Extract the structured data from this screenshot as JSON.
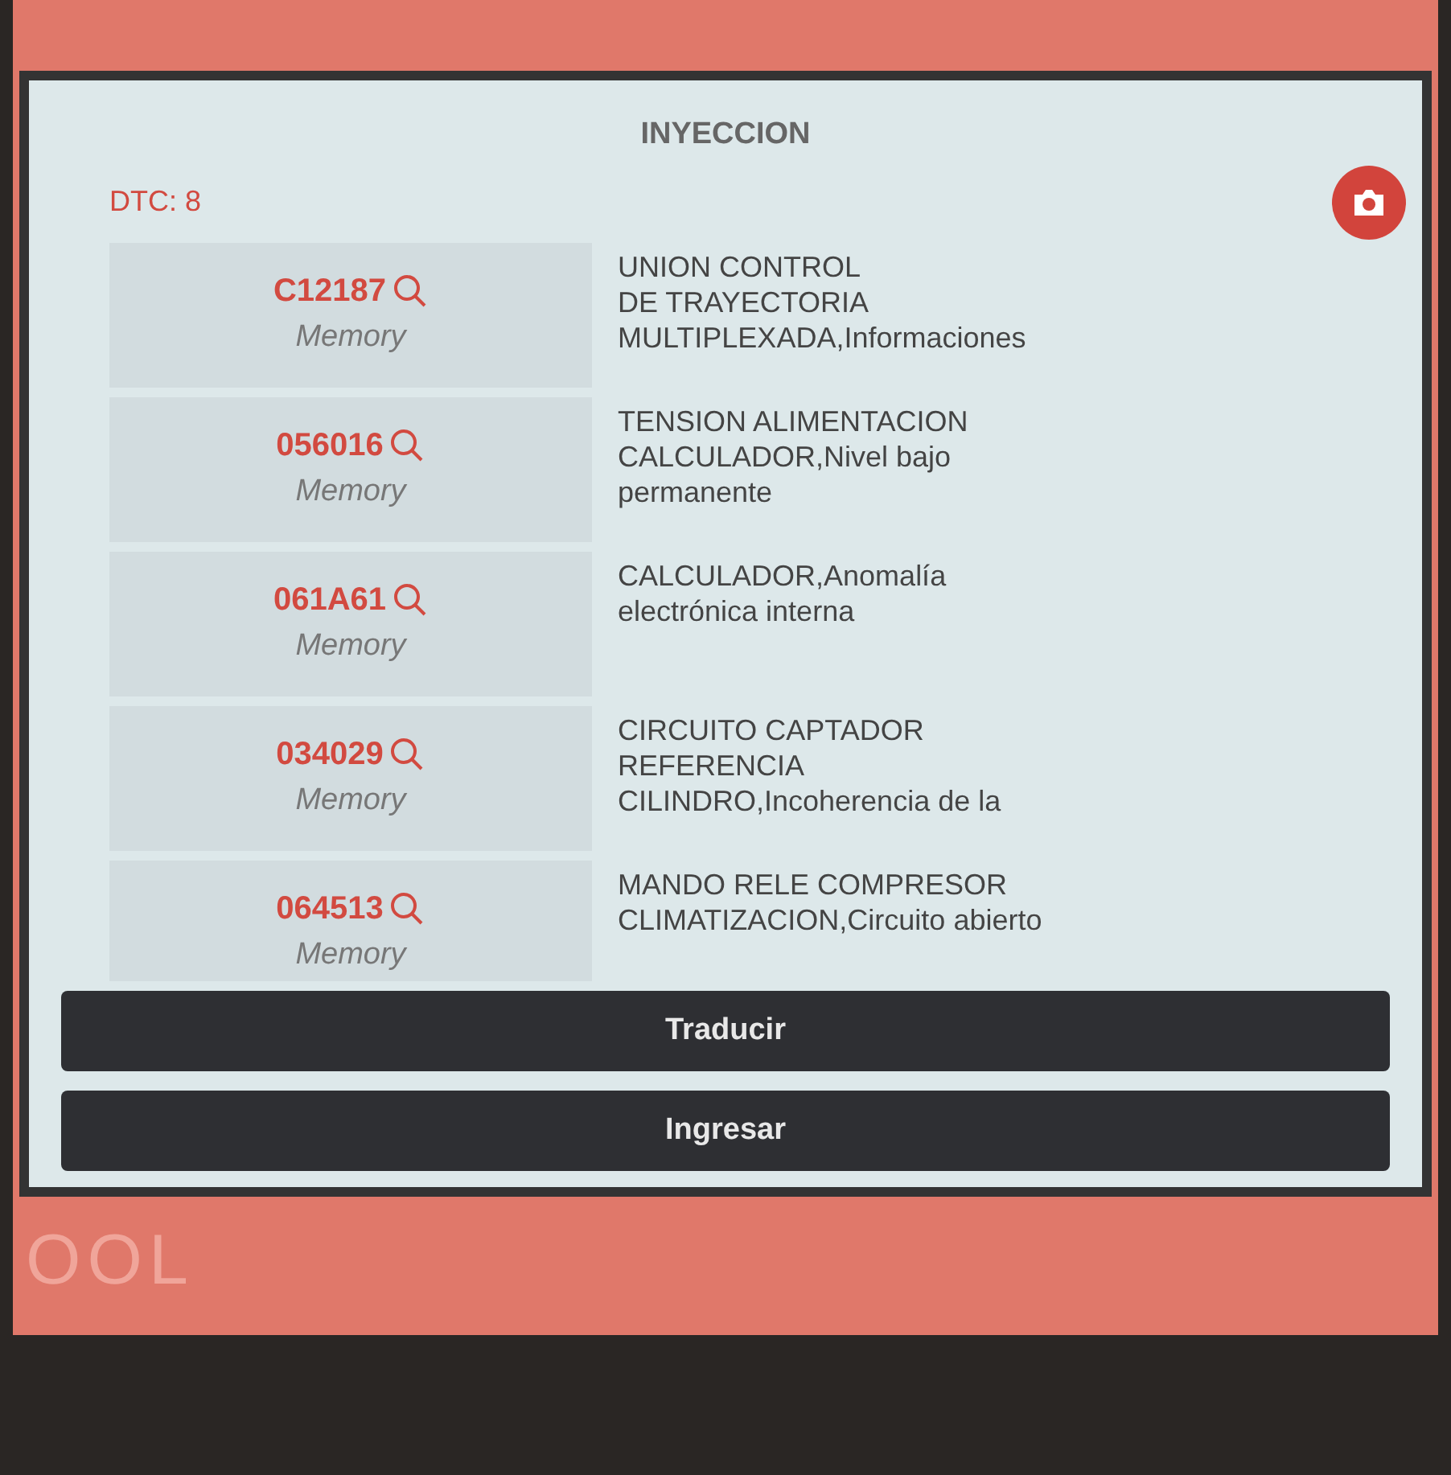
{
  "screen": {
    "title": "INYECCION",
    "dtc_count": "DTC: 8"
  },
  "dtcs": [
    {
      "code": "C12187",
      "status": "Memory",
      "description": "UNION CONTROL\nDE TRAYECTORIA\nMULTIPLEXADA,Informaciones"
    },
    {
      "code": "056016",
      "status": "Memory",
      "description": "TENSION ALIMENTACION\nCALCULADOR,Nivel bajo\npermanente"
    },
    {
      "code": "061A61",
      "status": "Memory",
      "description": "CALCULADOR,Anomalía\nelectrónica interna"
    },
    {
      "code": "034029",
      "status": "Memory",
      "description": "CIRCUITO CAPTADOR\nREFERENCIA\nCILINDRO,Incoherencia de la"
    },
    {
      "code": "064513",
      "status": "Memory",
      "description": "MANDO RELE COMPRESOR\nCLIMATIZACION,Circuito abierto"
    }
  ],
  "buttons": [
    "Traducir",
    "Ingresar"
  ],
  "device": {
    "logo": "OOL"
  }
}
